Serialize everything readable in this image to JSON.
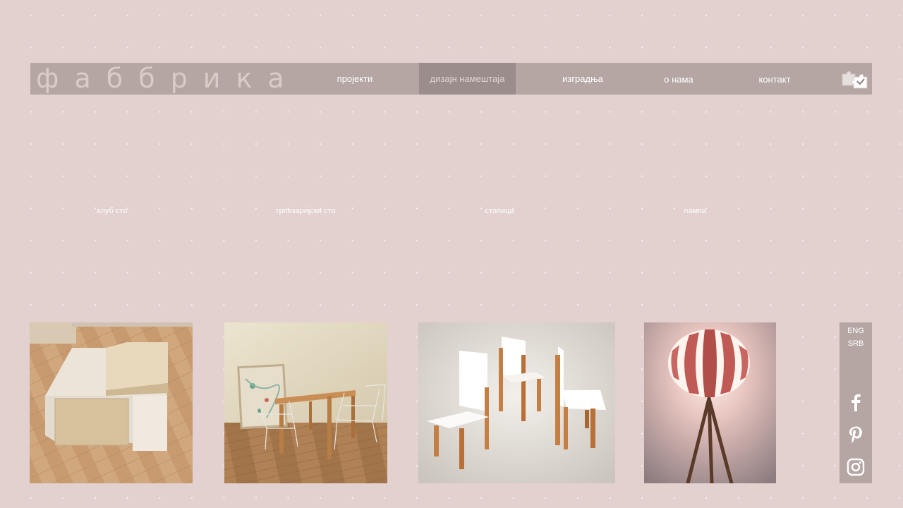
{
  "header": {
    "logo": "фаббрика",
    "nav": [
      {
        "label": "пројекти"
      },
      {
        "label": "дизајн намештаја"
      },
      {
        "label": "изградња"
      },
      {
        "label": "о нама"
      },
      {
        "label": "контакт"
      }
    ],
    "logo_icon": "puzzle-icon"
  },
  "products": [
    {
      "caption": "клуб сто",
      "image": "club-table-image"
    },
    {
      "caption": "трпезаријски сто",
      "image": "dining-table-image"
    },
    {
      "caption": "столица",
      "image": "chairs-image"
    },
    {
      "caption": "лампа",
      "image": "lamp-image"
    }
  ],
  "side_panel": {
    "languages": [
      "ENG",
      "SRB"
    ],
    "social": [
      "facebook-icon",
      "pinterest-icon",
      "instagram-icon"
    ]
  },
  "colors": {
    "background": "#e2d1cf",
    "nav_bar": "#b5a6a3",
    "nav_active": "#9a8d8b",
    "text": "#ffffff"
  }
}
